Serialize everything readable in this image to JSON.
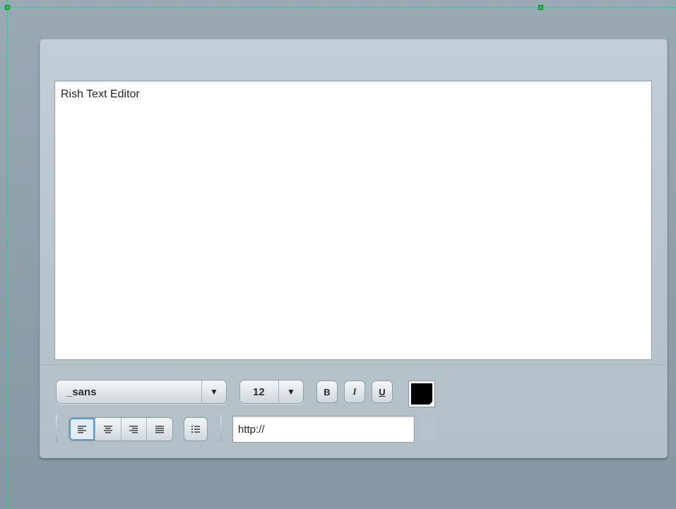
{
  "editor": {
    "content": "Rish Text Editor"
  },
  "toolbar": {
    "font_family": "_sans",
    "font_size": "12",
    "bold_label": "B",
    "italic_label": "I",
    "underline_label": "U",
    "text_color": "#000000",
    "align_left_glyph": "≡",
    "align_center_glyph": "≡",
    "align_right_glyph": "≡",
    "align_justify_glyph": "≡",
    "list_glyph": "☰",
    "dropdown_arrow": "▼",
    "url_value": "http://"
  },
  "icons": {
    "align_left": "align-left-icon",
    "align_center": "align-center-icon",
    "align_right": "align-right-icon",
    "align_justify": "align-justify-icon",
    "bullet_list": "bullet-list-icon",
    "dropdown": "chevron-down-icon"
  },
  "colors": {
    "accent": "#5b9bd6",
    "selection_guide": "#27d08a"
  }
}
